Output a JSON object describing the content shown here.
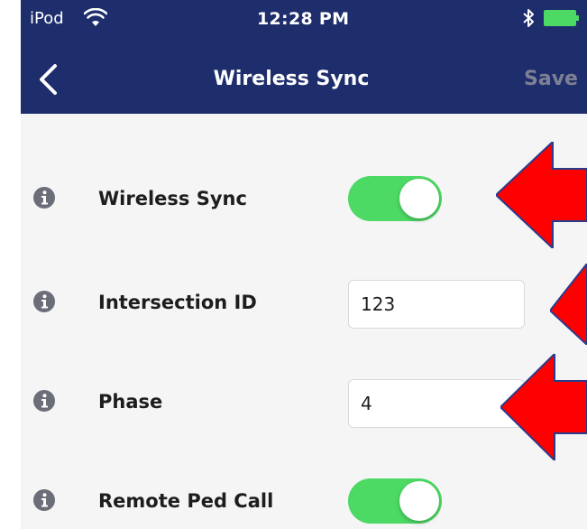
{
  "status_bar": {
    "carrier": "iPod",
    "time": "12:28 PM"
  },
  "nav": {
    "title": "Wireless Sync",
    "save_label": "Save"
  },
  "rows": [
    {
      "label": "Wireless Sync",
      "type": "toggle",
      "on": true
    },
    {
      "label": "Intersection ID",
      "type": "text",
      "value": "123"
    },
    {
      "label": "Phase",
      "type": "text",
      "value": "4"
    },
    {
      "label": "Remote Ped Call",
      "type": "toggle",
      "on": true
    }
  ],
  "colors": {
    "header_bg": "#1e2d6b",
    "toggle_on": "#4cd964",
    "info_icon": "#6b6e78",
    "annotation_arrow": "#ff0000"
  },
  "icons": {
    "back": "chevron-left-icon",
    "info": "info-circle-icon",
    "wifi": "wifi-icon",
    "bluetooth": "bluetooth-icon",
    "battery": "battery-icon",
    "annotation": "red-arrow-icon"
  }
}
